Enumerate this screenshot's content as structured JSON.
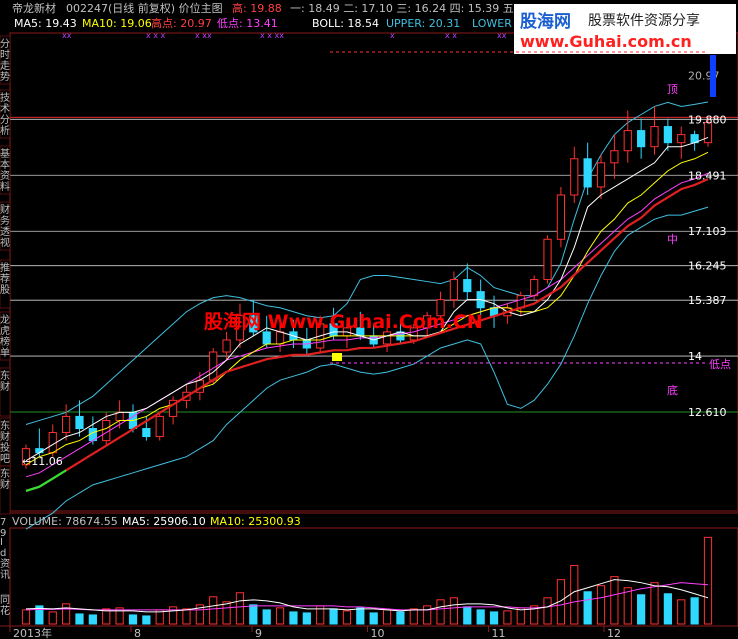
{
  "header": {
    "stock_name": "帝龙新材",
    "code": "002247(日线 前复权) 价位主图",
    "high_label": "高: 19.88",
    "levels": "一: 18.49  二: 17.10  三: 16.24  四: 15.39  五",
    "ma_line": {
      "ma5": "MA5: 19.43",
      "ma10": "MA10: 19.06",
      "high_pt": "高点: 20.97",
      "low_pt": "低点: 13.41"
    },
    "boll_line": {
      "boll": "BOLL: 18.54",
      "upper": "UPPER: 20.31",
      "lower": "LOWER"
    }
  },
  "sidebar_tabs": [
    {
      "label": "分时走势"
    },
    {
      "label": "技术分析"
    },
    {
      "label": "基本资料"
    },
    {
      "label": "财务透视"
    },
    {
      "label": "推荐股"
    },
    {
      "label": "龙虎榜单"
    },
    {
      "label": "东财"
    },
    {
      "label": "东财投吧"
    },
    {
      "label": "东财"
    }
  ],
  "watermark": {
    "logo_text": "股海网",
    "slogan": "股票软件资源分享",
    "url": "www.Guhai.com.cn",
    "center": "股海网 Www.Guhai.Com.CN"
  },
  "price_levels": [
    {
      "label": "20.97",
      "value": 20.97,
      "color": "#b0b0b0"
    },
    {
      "label": "19.880",
      "value": 19.88,
      "color": "#ffffff"
    },
    {
      "label": "18.491",
      "value": 18.49,
      "color": "#ffffff"
    },
    {
      "label": "17.103",
      "value": 17.1,
      "color": "#ffffff"
    },
    {
      "label": "16.245",
      "value": 16.245,
      "color": "#ffffff"
    },
    {
      "label": "15.387",
      "value": 15.387,
      "color": "#ffffff"
    },
    {
      "label": "14",
      "value": 14.0,
      "color": "#ffffff"
    },
    {
      "label": "12.610",
      "value": 12.61,
      "color": "#ffffff"
    }
  ],
  "annotations": {
    "top": "顶",
    "mid": "中",
    "bottom": "底",
    "low_point": "低点",
    "start_low": "←11.06"
  },
  "volume_header": {
    "volume": "VOLUME: 78674.55",
    "ma5": "MA5: 25906.10",
    "ma10": "MA10: 25300.93"
  },
  "volume_tabs": [
    {
      "label": "79"
    },
    {
      "label": "Id"
    },
    {
      "label": "资讯"
    },
    {
      "label": "同花"
    }
  ],
  "x_axis": [
    {
      "label": "2013年",
      "x": 0
    },
    {
      "label": "8",
      "x": 22
    },
    {
      "label": "9",
      "x": 44
    },
    {
      "label": "10",
      "x": 65
    },
    {
      "label": "11",
      "x": 87
    },
    {
      "label": "12",
      "x": 108
    }
  ],
  "colors": {
    "up": "#ff3030",
    "down": "#2fd8ff",
    "ma_white": "#ffffff",
    "ma_yellow": "#ffff00",
    "ma_magenta": "#ff40ff",
    "ma_red": "#e02020",
    "boll_band": "#40c0e0",
    "green_seg": "#30e030",
    "grid": "#a02020",
    "watermark_red": "#ff0000",
    "blue_bar": "#1040ff"
  },
  "chart_data": {
    "type": "candlestick",
    "ylim": [
      10.3,
      21.9
    ],
    "series": [
      {
        "name": "MA5",
        "values": [
          11.4,
          11.6,
          11.8,
          12.0,
          12.1,
          12.3,
          12.5,
          12.6,
          12.6,
          12.7,
          12.9,
          13.1,
          13.3,
          13.4,
          13.6,
          13.9,
          14.3,
          14.5,
          14.7,
          14.6,
          14.5,
          14.4,
          14.5,
          14.6,
          14.6,
          14.5,
          14.4,
          14.5,
          14.6,
          14.5,
          14.5,
          14.6,
          15.1,
          15.4,
          15.4,
          15.3,
          15.1,
          15.0,
          15.1,
          15.4,
          15.9,
          16.7,
          17.7,
          18.0,
          18.2,
          18.4,
          18.6,
          18.8,
          19.2,
          19.2,
          19.3,
          19.43
        ]
      },
      {
        "name": "MA10",
        "values": [
          11.3,
          11.5,
          11.6,
          11.8,
          11.9,
          12.1,
          12.2,
          12.4,
          12.4,
          12.5,
          12.7,
          12.8,
          13.0,
          13.2,
          13.3,
          13.6,
          13.9,
          14.1,
          14.3,
          14.3,
          14.4,
          14.4,
          14.4,
          14.5,
          14.5,
          14.5,
          14.5,
          14.5,
          14.5,
          14.5,
          14.5,
          14.6,
          14.8,
          15.0,
          15.1,
          15.2,
          15.2,
          15.1,
          15.1,
          15.2,
          15.5,
          16.0,
          16.6,
          17.1,
          17.4,
          17.8,
          18.0,
          18.3,
          18.6,
          18.8,
          18.9,
          19.06
        ]
      },
      {
        "name": "BOLL",
        "values": [
          11.0,
          11.1,
          11.3,
          11.5,
          11.7,
          11.9,
          12.1,
          12.3,
          12.5,
          12.7,
          12.9,
          13.1,
          13.3,
          13.5,
          13.7,
          13.9,
          14.0,
          14.1,
          14.2,
          14.25,
          14.3,
          14.3,
          14.35,
          14.4,
          14.4,
          14.45,
          14.45,
          14.5,
          14.55,
          14.6,
          14.7,
          14.8,
          14.9,
          15.0,
          15.1,
          15.2,
          15.3,
          15.4,
          15.5,
          15.7,
          15.9,
          16.2,
          16.5,
          16.8,
          17.1,
          17.4,
          17.6,
          17.9,
          18.1,
          18.3,
          18.4,
          18.54
        ]
      },
      {
        "name": "UPPER",
        "values": [
          12.3,
          12.4,
          12.5,
          12.6,
          12.8,
          13.0,
          13.3,
          13.6,
          13.9,
          14.2,
          14.5,
          14.8,
          15.1,
          15.3,
          15.45,
          15.5,
          15.45,
          15.35,
          15.25,
          15.2,
          15.1,
          15.0,
          14.95,
          15.0,
          15.3,
          15.9,
          16.0,
          16.0,
          15.95,
          15.9,
          15.85,
          15.8,
          15.9,
          16.2,
          16.0,
          15.7,
          15.6,
          15.5,
          15.5,
          15.7,
          16.3,
          17.4,
          18.4,
          19.0,
          19.5,
          19.8,
          20.0,
          20.2,
          20.3,
          20.2,
          20.25,
          20.31
        ]
      },
      {
        "name": "LOWER",
        "values": [
          9.7,
          9.9,
          10.1,
          10.4,
          10.6,
          10.8,
          10.9,
          11.0,
          11.1,
          11.2,
          11.3,
          11.4,
          11.5,
          11.7,
          11.9,
          12.3,
          12.6,
          12.9,
          13.2,
          13.4,
          13.5,
          13.6,
          13.75,
          13.8,
          13.7,
          13.6,
          13.55,
          13.6,
          13.7,
          13.8,
          14.0,
          14.2,
          14.3,
          14.4,
          14.3,
          13.6,
          12.8,
          12.7,
          12.9,
          13.3,
          13.8,
          14.5,
          15.3,
          16.0,
          16.6,
          17.0,
          17.2,
          17.4,
          17.5,
          17.5,
          17.6,
          17.7
        ]
      }
    ],
    "ohlc": [
      [
        11.3,
        11.8,
        11.2,
        11.7
      ],
      [
        11.7,
        12.2,
        11.5,
        11.6
      ],
      [
        11.6,
        12.3,
        11.5,
        12.1
      ],
      [
        12.1,
        12.8,
        11.9,
        12.5
      ],
      [
        12.5,
        12.9,
        12.0,
        12.2
      ],
      [
        12.2,
        12.5,
        11.8,
        11.9
      ],
      [
        11.9,
        12.6,
        11.8,
        12.4
      ],
      [
        12.4,
        12.9,
        12.2,
        12.6
      ],
      [
        12.6,
        12.8,
        12.1,
        12.2
      ],
      [
        12.2,
        12.5,
        11.9,
        12.0
      ],
      [
        12.0,
        12.6,
        11.9,
        12.5
      ],
      [
        12.5,
        13.0,
        12.3,
        12.9
      ],
      [
        12.9,
        13.3,
        12.7,
        13.1
      ],
      [
        13.1,
        13.6,
        12.9,
        13.4
      ],
      [
        13.4,
        14.2,
        13.3,
        14.1
      ],
      [
        14.1,
        14.6,
        13.9,
        14.4
      ],
      [
        14.4,
        15.3,
        14.2,
        15.0
      ],
      [
        15.0,
        15.4,
        14.5,
        14.6
      ],
      [
        14.6,
        15.0,
        14.2,
        14.3
      ],
      [
        14.3,
        14.8,
        14.1,
        14.6
      ],
      [
        14.6,
        14.9,
        14.2,
        14.4
      ],
      [
        14.4,
        14.7,
        14.0,
        14.2
      ],
      [
        14.2,
        15.0,
        14.1,
        14.8
      ],
      [
        14.8,
        15.2,
        14.4,
        14.5
      ],
      [
        14.5,
        14.9,
        14.2,
        14.7
      ],
      [
        14.7,
        15.1,
        14.4,
        14.5
      ],
      [
        14.5,
        14.8,
        14.2,
        14.3
      ],
      [
        14.3,
        14.7,
        14.1,
        14.6
      ],
      [
        14.6,
        14.9,
        14.3,
        14.4
      ],
      [
        14.4,
        14.8,
        14.3,
        14.7
      ],
      [
        14.7,
        15.1,
        14.5,
        15.0
      ],
      [
        15.0,
        15.6,
        14.9,
        15.4
      ],
      [
        15.4,
        16.1,
        15.2,
        15.9
      ],
      [
        15.9,
        16.3,
        15.4,
        15.6
      ],
      [
        15.6,
        15.9,
        15.0,
        15.2
      ],
      [
        15.2,
        15.5,
        14.7,
        15.0
      ],
      [
        15.0,
        15.3,
        14.8,
        15.2
      ],
      [
        15.2,
        15.6,
        15.0,
        15.5
      ],
      [
        15.5,
        16.0,
        15.4,
        15.9
      ],
      [
        15.9,
        17.0,
        15.8,
        16.9
      ],
      [
        16.9,
        18.2,
        16.7,
        18.0
      ],
      [
        18.0,
        19.2,
        17.8,
        18.9
      ],
      [
        18.9,
        19.3,
        18.0,
        18.2
      ],
      [
        18.2,
        19.0,
        17.9,
        18.8
      ],
      [
        18.8,
        19.5,
        18.4,
        19.1
      ],
      [
        19.1,
        20.1,
        18.8,
        19.6
      ],
      [
        19.6,
        19.9,
        18.9,
        19.2
      ],
      [
        19.2,
        20.2,
        19.0,
        19.7
      ],
      [
        19.7,
        19.9,
        19.1,
        19.3
      ],
      [
        19.3,
        19.7,
        18.9,
        19.5
      ],
      [
        19.5,
        19.6,
        19.1,
        19.3
      ],
      [
        19.3,
        19.9,
        19.2,
        19.8
      ]
    ],
    "volume": [
      14,
      18,
      12,
      20,
      10,
      9,
      15,
      16,
      9,
      8,
      14,
      17,
      15,
      19,
      27,
      22,
      31,
      19,
      14,
      16,
      12,
      11,
      18,
      15,
      13,
      16,
      11,
      14,
      12,
      15,
      18,
      24,
      26,
      17,
      14,
      12,
      13,
      16,
      18,
      26,
      44,
      58,
      32,
      38,
      47,
      36,
      29,
      41,
      30,
      24,
      26,
      86
    ],
    "volume_ma5": [
      15,
      15.5,
      15,
      16,
      15,
      14,
      13,
      13,
      13,
      12,
      12,
      13,
      14,
      16,
      18,
      20,
      23,
      24,
      23,
      21,
      17,
      15,
      15,
      15,
      14,
      15,
      15,
      14,
      13,
      14,
      14,
      17,
      19,
      20,
      20,
      19,
      16,
      14,
      15,
      17,
      23,
      32,
      36,
      40,
      44,
      43,
      41,
      38,
      37,
      34,
      30,
      26
    ],
    "volume_ma10": [
      14,
      14.5,
      14.5,
      15,
      14.5,
      14,
      14,
      14,
      14,
      14,
      14,
      14,
      14,
      14,
      15,
      16,
      17,
      18,
      18,
      18,
      18,
      18,
      18,
      18,
      17,
      17,
      16,
      15,
      14,
      14,
      14,
      15,
      16,
      17,
      17,
      17,
      17,
      16,
      16,
      17,
      19,
      22,
      24,
      26,
      29,
      32,
      35,
      37,
      39,
      41,
      40,
      39
    ]
  }
}
